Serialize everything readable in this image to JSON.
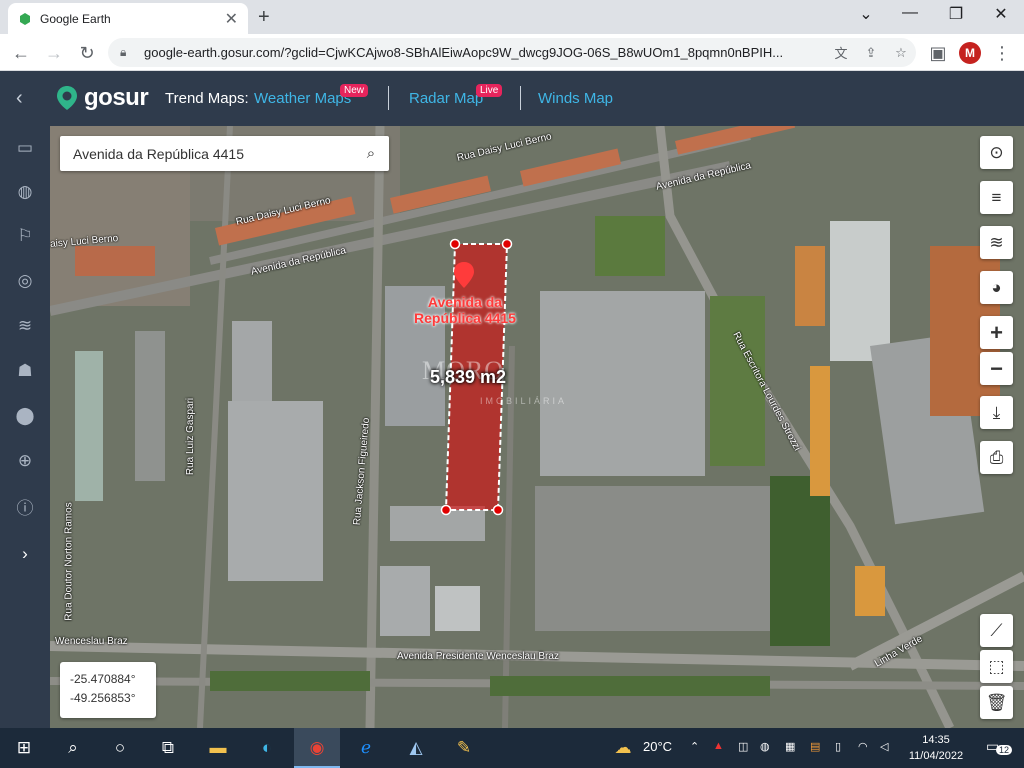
{
  "browser": {
    "tab_title": "Google Earth",
    "url": "google-earth.gosur.com/?gclid=CjwKCAjwo8-SBhAlEiwAopc9W_dwcg9JOG-06S_B8wUOm1_8pqmn0nBPIH...",
    "profile_initial": "M"
  },
  "site": {
    "brand": "gosur",
    "trend_label": "Trend Maps:",
    "links": [
      {
        "label": "Weather Maps",
        "badge": "New"
      },
      {
        "label": "Radar Map",
        "badge": "Live"
      },
      {
        "label": "Winds Map",
        "badge": ""
      }
    ]
  },
  "map": {
    "search_value": "Avenida da República 4415",
    "parcel_title_line1": "Avenida da",
    "parcel_title_line2": "República 4415",
    "area": "5,839 m2",
    "watermark": "MORO",
    "watermark_sub": "IMOBILIÁRIA",
    "latitude": "-25.470884°",
    "longitude": "-49.256853°",
    "street_labels": [
      "Rua Daisy Luci Berno",
      "Rua Daisy Luci Berno",
      "aisy Luci Berno",
      "Avenida da República",
      "Avenida da República",
      "Rua Luiz Gaspari",
      "Rua Jackson Figueiredo",
      "Rua Escritora Lourdes Strozzi",
      "Rua Doutor Norton Ramos",
      "Wenceslau Braz",
      "Avenida Presidente Wenceslau Braz",
      "Linha Verde"
    ]
  },
  "taskbar": {
    "weather": "20°C",
    "time": "14:35",
    "date": "11/04/2022",
    "notifications": "12"
  }
}
